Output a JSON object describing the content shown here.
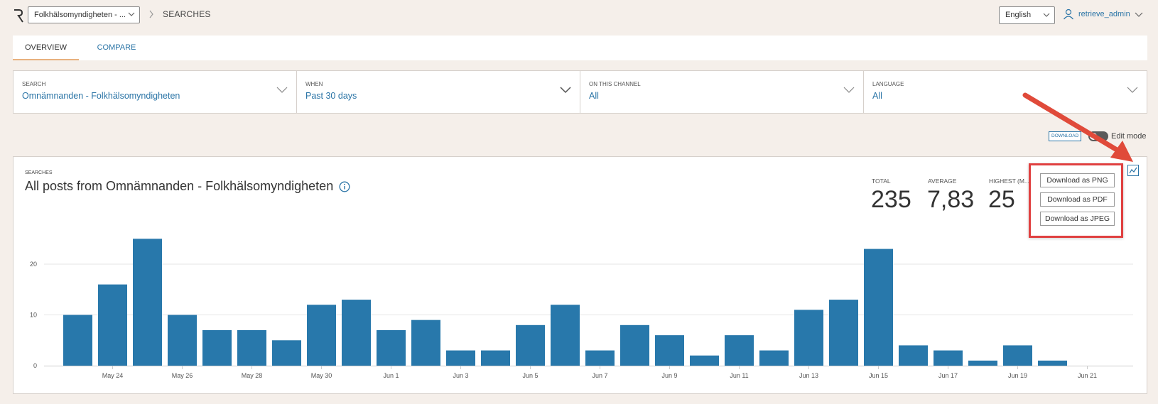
{
  "header": {
    "org_select": "Folkhälsomyndigheten - ...",
    "breadcrumb": "SEARCHES",
    "language": "English",
    "user": "retrieve_admin"
  },
  "tabs": [
    {
      "label": "OVERVIEW",
      "active": true
    },
    {
      "label": "COMPARE",
      "active": false
    }
  ],
  "filters": [
    {
      "label": "SEARCH",
      "value": "Omnämnanden - Folkhälsomyndigheten"
    },
    {
      "label": "WHEN",
      "value": "Past 30 days"
    },
    {
      "label": "ON THIS CHANNEL",
      "value": "All"
    },
    {
      "label": "LANGUAGE",
      "value": "All"
    }
  ],
  "toolbar": {
    "download_label": "DOWNLOAD",
    "edit_mode_label": "Edit mode",
    "edit_mode_on": false
  },
  "card": {
    "eyebrow": "SEARCHES",
    "title": "All posts from Omnämnanden - Folkhälsomyndigheten",
    "stats": [
      {
        "label": "TOTAL",
        "value": "235"
      },
      {
        "label": "AVERAGE",
        "value": "7,83"
      },
      {
        "label": "HIGHEST (M...",
        "value": "25"
      }
    ]
  },
  "download_menu": [
    "Download as PNG",
    "Download as PDF",
    "Download as JPEG"
  ],
  "colors": {
    "accent": "#2a74a6",
    "bar": "#2878ab",
    "highlight": "#e04040",
    "tab_underline": "#e8b17e"
  },
  "chart_data": {
    "type": "bar",
    "categories": [
      "May 23",
      "May 24",
      "May 25",
      "May 26",
      "May 27",
      "May 28",
      "May 29",
      "May 30",
      "May 31",
      "Jun 1",
      "Jun 2",
      "Jun 3",
      "Jun 4",
      "Jun 5",
      "Jun 6",
      "Jun 7",
      "Jun 8",
      "Jun 9",
      "Jun 10",
      "Jun 11",
      "Jun 12",
      "Jun 13",
      "Jun 14",
      "Jun 15",
      "Jun 16",
      "Jun 17",
      "Jun 18",
      "Jun 19",
      "Jun 20",
      "Jun 21"
    ],
    "values": [
      10,
      16,
      25,
      10,
      7,
      7,
      5,
      12,
      13,
      7,
      9,
      3,
      3,
      8,
      12,
      3,
      8,
      6,
      2,
      6,
      3,
      11,
      13,
      23,
      4,
      3,
      1,
      4,
      1,
      0
    ],
    "tick_labels": [
      "May 24",
      "May 26",
      "May 28",
      "May 30",
      "Jun 1",
      "Jun 3",
      "Jun 5",
      "Jun 7",
      "Jun 9",
      "Jun 11",
      "Jun 13",
      "Jun 15",
      "Jun 17",
      "Jun 19",
      "Jun 21"
    ],
    "yticks": [
      0,
      10,
      20
    ],
    "ylim": [
      0,
      27
    ],
    "grid": true
  }
}
